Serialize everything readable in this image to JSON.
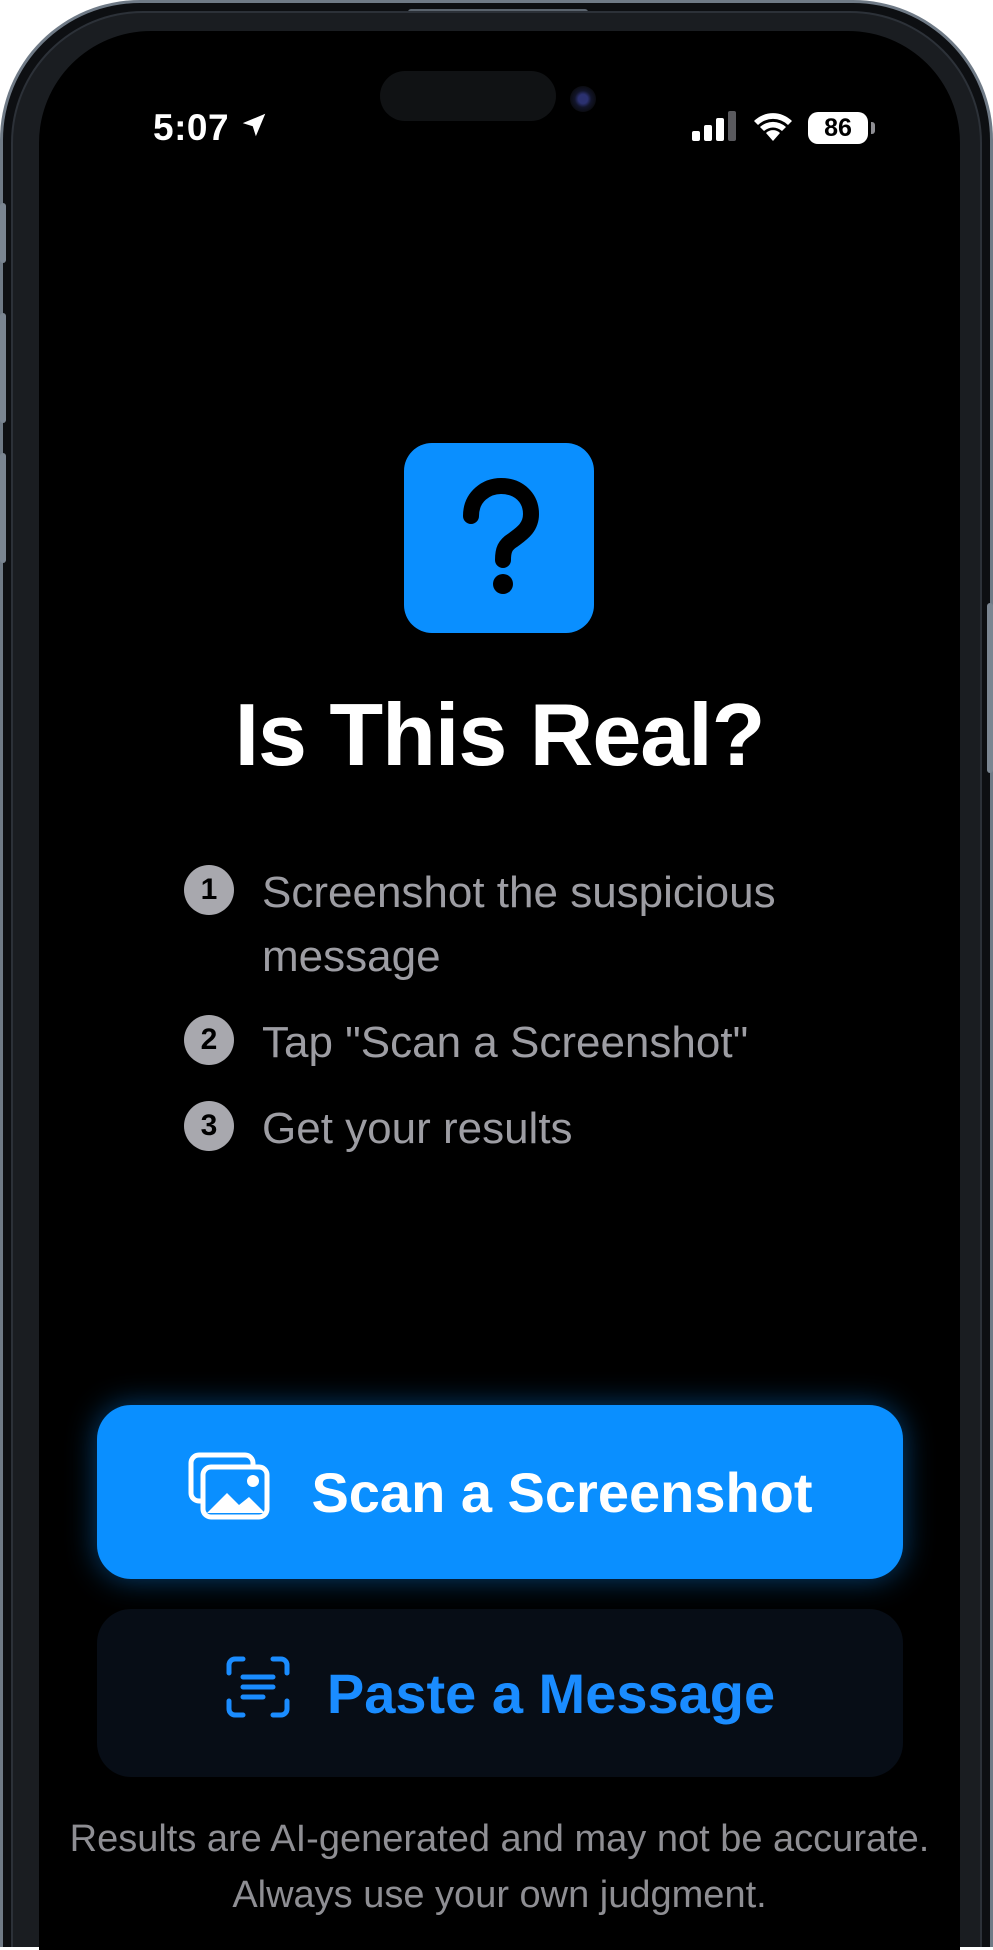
{
  "status_bar": {
    "time": "5:07",
    "battery_level": "86",
    "icons": [
      "location-arrow-icon",
      "cellular-signal-icon",
      "wifi-icon",
      "battery-icon"
    ]
  },
  "app": {
    "icon": "question-mark-icon",
    "title": "Is This Real?"
  },
  "steps": [
    {
      "number": "1",
      "text": "Screenshot the suspicious message"
    },
    {
      "number": "2",
      "text": "Tap \"Scan a Screenshot\""
    },
    {
      "number": "3",
      "text": "Get your results"
    }
  ],
  "actions": {
    "scan": {
      "label": "Scan a Screenshot",
      "icon": "photos-icon"
    },
    "paste": {
      "label": "Paste a Message",
      "icon": "text-scan-icon"
    }
  },
  "disclaimer": "Results are AI-generated and may not be accurate. Always use your own judgment.",
  "colors": {
    "accent": "#0a8fff",
    "background": "#000000",
    "secondary_text": "#9d9da3"
  }
}
